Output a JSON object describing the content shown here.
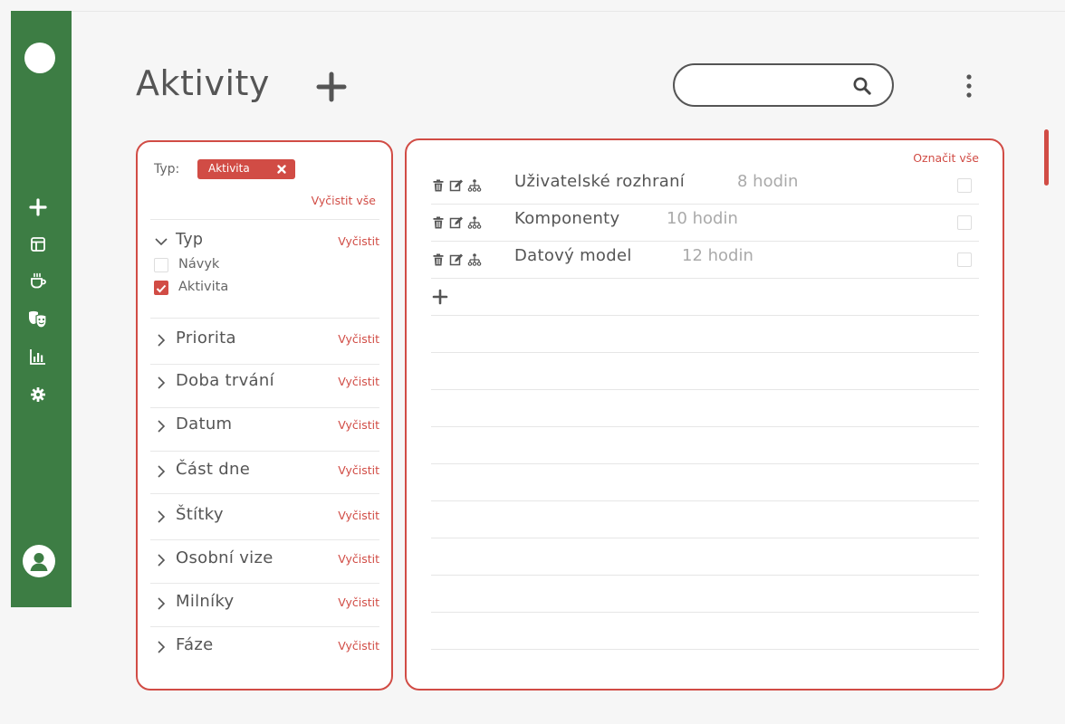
{
  "header": {
    "title": "Aktivity",
    "search": {
      "value": "",
      "placeholder": ""
    }
  },
  "sidebar": {
    "items": [
      {
        "icon": "plus-icon"
      },
      {
        "icon": "dashboard-icon"
      },
      {
        "icon": "coffee-icon"
      },
      {
        "icon": "theater-masks-icon"
      },
      {
        "icon": "bar-chart-icon"
      },
      {
        "icon": "gear-icon"
      }
    ],
    "profile_icon": "user-icon"
  },
  "filters": {
    "type_label": "Typ:",
    "active_chip": "Aktivita",
    "clear_all": "Vyčistit vše",
    "type_section": {
      "title": "Typ",
      "clear": "Vyčistit",
      "options": [
        {
          "label": "Návyk",
          "checked": false
        },
        {
          "label": "Aktivita",
          "checked": true
        }
      ]
    },
    "sections": [
      {
        "title": "Priorita",
        "clear": "Vyčistit"
      },
      {
        "title": "Doba trvání",
        "clear": "Vyčistit"
      },
      {
        "title": "Datum",
        "clear": "Vyčistit"
      },
      {
        "title": "Část dne",
        "clear": "Vyčistit"
      },
      {
        "title": "Štítky",
        "clear": "Vyčistit"
      },
      {
        "title": "Osobní vize",
        "clear": "Vyčistit"
      },
      {
        "title": "Milníky",
        "clear": "Vyčistit"
      },
      {
        "title": "Fáze",
        "clear": "Vyčistit"
      }
    ]
  },
  "activities": {
    "mark_all": "Označit vše",
    "rows": [
      {
        "name": "Uživatelské rozhraní",
        "hours": "8 hodin",
        "checked": false
      },
      {
        "name": "Komponenty",
        "hours": "10 hodin",
        "checked": false
      },
      {
        "name": "Datový model",
        "hours": "12 hodin",
        "checked": false
      }
    ]
  },
  "colors": {
    "sidebar": "#3d7d44",
    "accent": "#d14c45",
    "text": "#555555",
    "muted": "#aaaaaa"
  }
}
